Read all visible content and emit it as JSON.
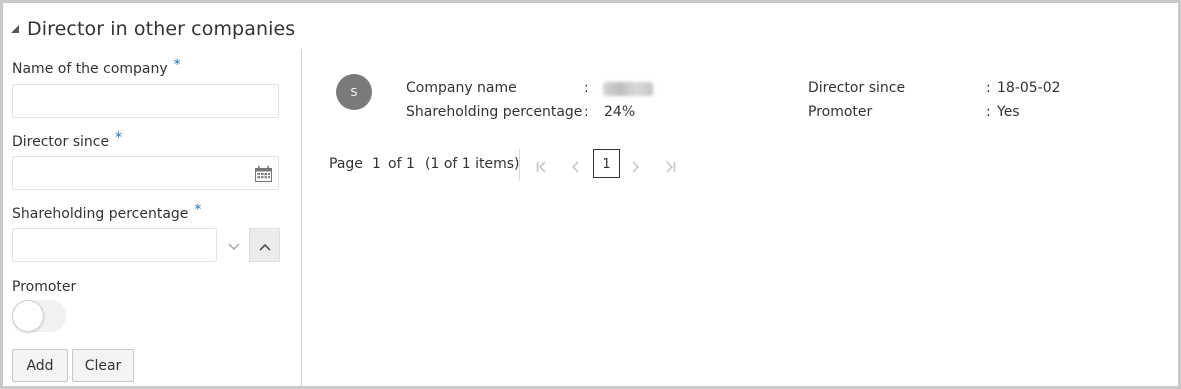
{
  "section": {
    "title": "Director in other companies"
  },
  "form": {
    "company_name_label": "Name of the company",
    "company_name_value": "",
    "director_since_label": "Director since",
    "director_since_value": "",
    "shareholding_label": "Shareholding percentage",
    "shareholding_value": "",
    "promoter_label": "Promoter",
    "promoter_on": false,
    "required_mark": "*",
    "add_label": "Add",
    "clear_label": "Clear"
  },
  "record": {
    "avatar_initial": "S",
    "company_name_key": "Company name",
    "company_name_sep": ":",
    "shareholding_key": "Shareholding percentage",
    "shareholding_sep": ":",
    "shareholding_value": "24%",
    "director_since_key": "Director since",
    "director_since_sep": ":",
    "director_since_value": "18-05-02",
    "promoter_key": "Promoter",
    "promoter_sep": ":",
    "promoter_value": "Yes"
  },
  "pagination": {
    "page_word": "Page",
    "current_page": "1",
    "of_text": "of 1",
    "items_text": "(1 of 1 items)",
    "page_box": "1"
  },
  "colors": {
    "required_accent": "#1f6fb5",
    "avatar_bg": "#7a7a7a"
  },
  "icons": [
    "collapse-triangle-icon",
    "calendar-icon",
    "chevron-down-icon",
    "chevron-up-icon",
    "first-page-icon",
    "previous-page-icon",
    "next-page-icon",
    "last-page-icon"
  ]
}
